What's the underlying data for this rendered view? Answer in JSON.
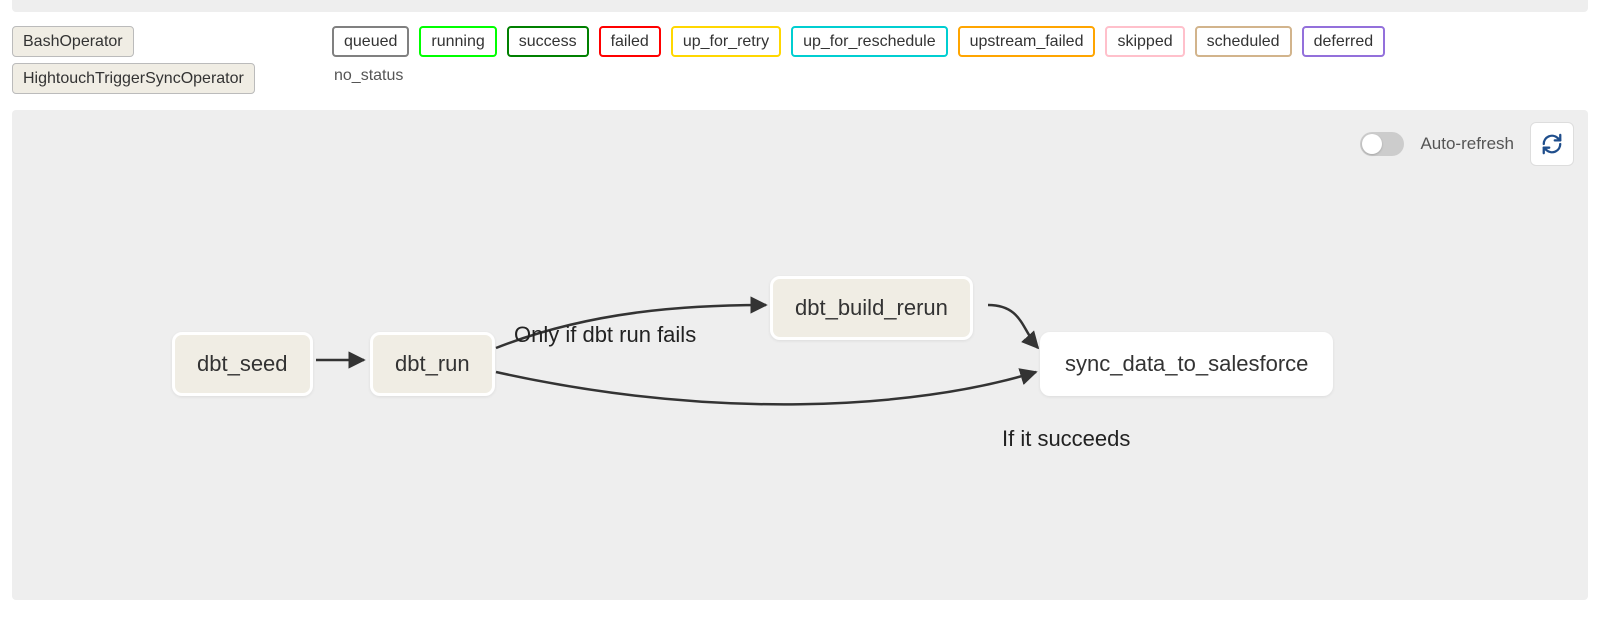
{
  "operators": [
    {
      "name": "BashOperator"
    },
    {
      "name": "HightouchTriggerSyncOperator"
    }
  ],
  "statuses": [
    {
      "name": "queued",
      "color": "#808080"
    },
    {
      "name": "running",
      "color": "#00ff00"
    },
    {
      "name": "success",
      "color": "#008000"
    },
    {
      "name": "failed",
      "color": "#ff0000"
    },
    {
      "name": "up_for_retry",
      "color": "#ffd700"
    },
    {
      "name": "up_for_reschedule",
      "color": "#00ced1"
    },
    {
      "name": "upstream_failed",
      "color": "#ffa500"
    },
    {
      "name": "skipped",
      "color": "#ffc0cb"
    },
    {
      "name": "scheduled",
      "color": "#d2b48c"
    },
    {
      "name": "deferred",
      "color": "#9370db"
    }
  ],
  "no_status_label": "no_status",
  "auto_refresh": {
    "label": "Auto-refresh",
    "enabled": false
  },
  "nodes": {
    "dbt_seed": {
      "label": "dbt_seed"
    },
    "dbt_run": {
      "label": "dbt_run"
    },
    "dbt_build_rerun": {
      "label": "dbt_build_rerun"
    },
    "sync_data_to_salesforce": {
      "label": "sync_data_to_salesforce"
    }
  },
  "annotations": {
    "fail_path": "Only if dbt run fails",
    "success_path": "If it succeeds"
  },
  "chart_data": {
    "type": "diagram",
    "title": "DAG graph",
    "nodes": [
      {
        "id": "dbt_seed",
        "operator": "BashOperator"
      },
      {
        "id": "dbt_run",
        "operator": "BashOperator"
      },
      {
        "id": "dbt_build_rerun",
        "operator": "BashOperator"
      },
      {
        "id": "sync_data_to_salesforce",
        "operator": "HightouchTriggerSyncOperator"
      }
    ],
    "edges": [
      {
        "from": "dbt_seed",
        "to": "dbt_run"
      },
      {
        "from": "dbt_run",
        "to": "dbt_build_rerun",
        "condition": "Only if dbt run fails"
      },
      {
        "from": "dbt_run",
        "to": "sync_data_to_salesforce",
        "condition": "If it succeeds"
      },
      {
        "from": "dbt_build_rerun",
        "to": "sync_data_to_salesforce"
      }
    ]
  }
}
